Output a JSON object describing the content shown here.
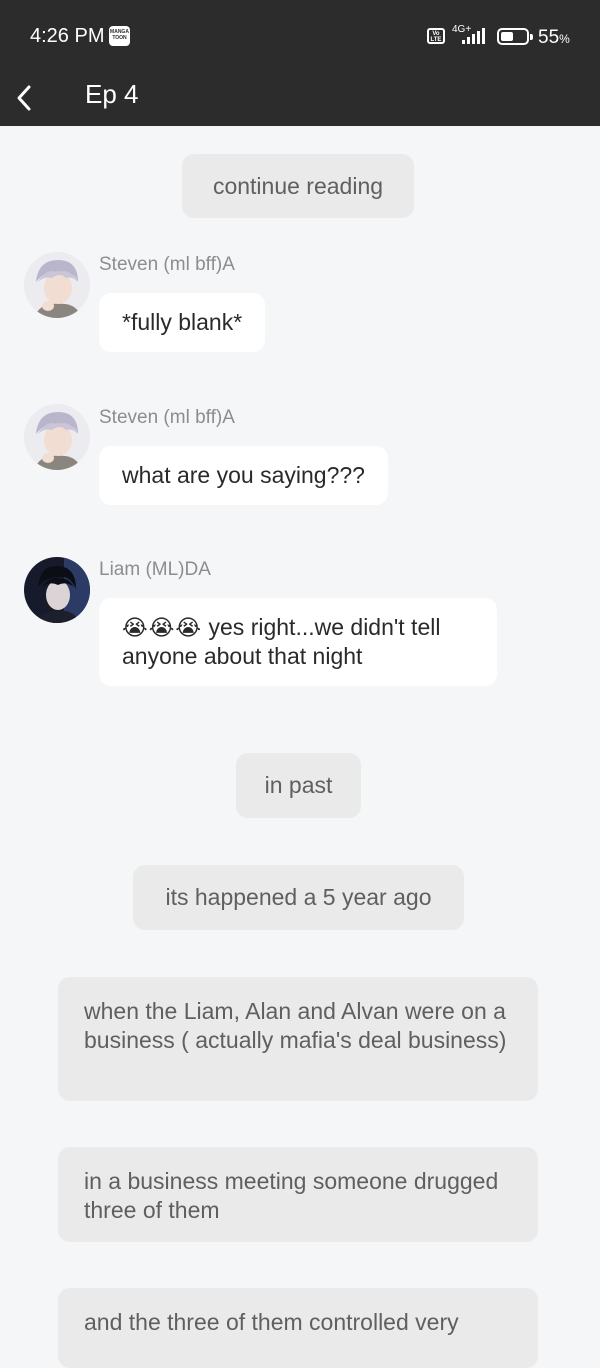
{
  "status_bar": {
    "time": "4:26 PM",
    "app_icon": "MANGA TOON",
    "network_label": "4G+",
    "volte_label": "Vo LTE",
    "battery_percent": "55",
    "battery_unit": "%",
    "icons": [
      "manga-toon-icon",
      "volte-icon",
      "signal-icon",
      "battery-icon"
    ]
  },
  "app_bar": {
    "back_icon": "chevron-left-icon",
    "title": "Ep 4"
  },
  "chat": {
    "narration_top": "continue reading",
    "messages": [
      {
        "sender": "Steven (ml bff)A",
        "text": "*fully blank*",
        "avatar": "steven-avatar"
      },
      {
        "sender": "Steven (ml bff)A",
        "text": "what are you saying???",
        "avatar": "steven-avatar"
      },
      {
        "sender": "Liam (ML)DA",
        "emoji": "😭😭😭",
        "text": " yes right...we didn't tell anyone about that night",
        "avatar": "liam-avatar"
      }
    ],
    "narrations": [
      "in past",
      "its happened a 5 year ago",
      "when the Liam, Alan and Alvan were on a business ( actually mafia's deal business)",
      "in a business meeting someone drugged three of them",
      "and the three of them controlled very"
    ]
  },
  "colors": {
    "bar_bg": "#2c2c2c",
    "page_bg": "#f5f6f8",
    "narration_bg": "#eaeaea",
    "bubble_bg": "#ffffff"
  }
}
